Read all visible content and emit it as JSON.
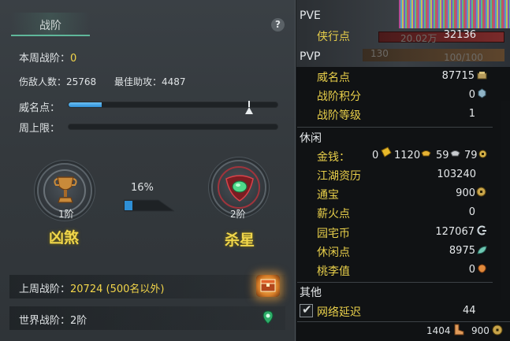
{
  "left_panel": {
    "title": "战阶",
    "help": "?",
    "weekly_label": "本周战阶：",
    "weekly_value": "0",
    "defeated_label": "伤敌人数：",
    "defeated_value": "25768",
    "assist_label": "最佳助攻：",
    "assist_value": "4487",
    "prestige_label": "威名点：",
    "prestige_fraction": 0.16,
    "cap_label": "周上限：",
    "current_rank_level": "1阶",
    "current_rank_name": "凶煞",
    "next_rank_level": "2阶",
    "next_rank_name": "杀星",
    "progress_percent": "16%",
    "progress_fraction": 0.16,
    "last_week_label": "上周战阶：",
    "last_week_value": "20724 (500名以外)",
    "world_rank_label": "世界战阶：",
    "world_rank_value": "2阶"
  },
  "overlay": {
    "bar_text": "20.02万",
    "num_130": "130",
    "mana": "100/100"
  },
  "right_panel": {
    "pve_header": "PVE",
    "pve_items": [
      {
        "label": "侠行点",
        "value": "32136"
      }
    ],
    "pvp_header": "PVP",
    "pvp_items": [
      {
        "label": "威名点",
        "value": "87715"
      },
      {
        "label": "战阶积分",
        "value": "0"
      },
      {
        "label": "战阶等级",
        "value": "1"
      }
    ],
    "leisure_header": "休闲",
    "money_label": "金钱：",
    "money_values": [
      "0",
      "1120",
      "59",
      "79"
    ],
    "leisure_items": [
      {
        "label": "江湖资历",
        "value": "103240"
      },
      {
        "label": "通宝",
        "value": "900"
      },
      {
        "label": "薪火点",
        "value": "0"
      },
      {
        "label": "园宅币",
        "value": "127067"
      },
      {
        "label": "休闲点",
        "value": "8975"
      },
      {
        "label": "桃李值",
        "value": "0"
      }
    ],
    "other_header": "其他",
    "latency_label": "网络延迟",
    "latency_value": "44",
    "latency_checked": "✔",
    "footer_a": "1404",
    "footer_b": "900"
  },
  "colors": {
    "label_gold": "#e8cf4a",
    "rank_gold": "#f0d64a",
    "progress_blue": "#2e8fd6",
    "accent_green": "#5fb79a"
  }
}
